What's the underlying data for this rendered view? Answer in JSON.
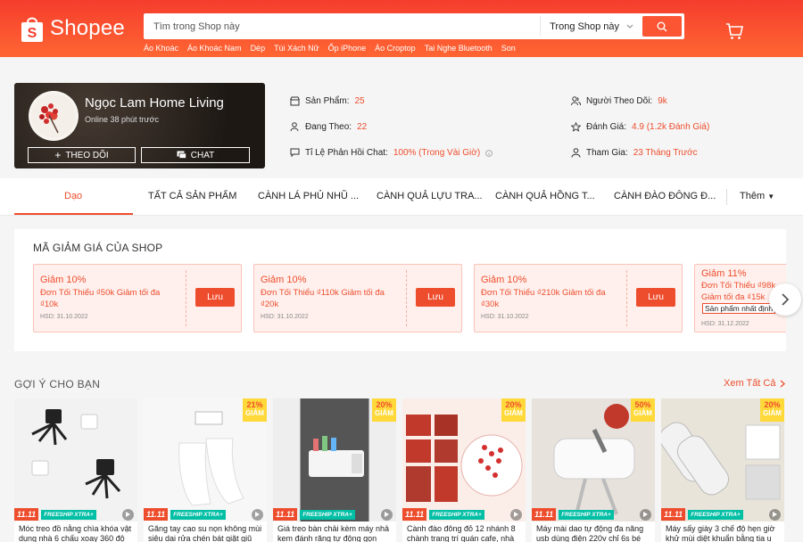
{
  "header": {
    "logo_text": "Shopee",
    "search_placeholder": "Tìm trong Shop này",
    "search_scope": "Trong Shop này",
    "quick_links": [
      "Áo Khoác",
      "Áo Khoác Nam",
      "Dép",
      "Túi Xách Nữ",
      "Ốp iPhone",
      "Áo Croptop",
      "Tai Nghe Bluetooth",
      "Son"
    ]
  },
  "shop": {
    "name": "Ngọc Lam Home Living",
    "online": "Online 38 phút trước",
    "follow_label": "THEO DÕI",
    "chat_label": "CHAT"
  },
  "stats": {
    "products_label": "Sản Phẩm:",
    "products_value": "25",
    "following_label": "Đang Theo:",
    "following_value": "22",
    "chat_rate_label": "Tỉ Lệ Phản Hồi Chat:",
    "chat_rate_value": "100% (Trong Vài Giờ)",
    "followers_label": "Người Theo Dõi:",
    "followers_value": "9k",
    "rating_label": "Đánh Giá:",
    "rating_value": "4.9 (1.2k Đánh Giá)",
    "joined_label": "Tham Gia:",
    "joined_value": "23 Tháng Trước"
  },
  "tabs": [
    "Dạo",
    "TẤT CẢ SẢN PHẨM",
    "CÀNH LÁ PHỦ NHŨ ...",
    "CÀNH QUẢ LỰU TRA...",
    "CÀNH QUẢ HỒNG T...",
    "CÀNH ĐÀO ĐÔNG Đ...",
    "Thêm"
  ],
  "vouchers": {
    "title": "MÃ GIẢM GIÁ CỦA SHOP",
    "button_label": "Lưu",
    "items": [
      {
        "title": "Giảm 10%",
        "desc": "Đơn Tối Thiểu ₫50k Giảm tối đa ₫10k",
        "hsd": "HSD: 31.10.2022"
      },
      {
        "title": "Giảm 10%",
        "desc": "Đơn Tối Thiểu ₫110k Giảm tối đa ₫20k",
        "hsd": "HSD: 31.10.2022"
      },
      {
        "title": "Giảm 10%",
        "desc": "Đơn Tối Thiểu ₫210k Giảm tối đa ₫30k",
        "hsd": "HSD: 31.10.2022"
      },
      {
        "title": "Giảm 11%",
        "desc": "Đơn Tối Thiểu ₫98k Giảm tối đa ₫15k",
        "tag": "Sản phẩm nhất định",
        "hsd": "HSD: 31.12.2022"
      }
    ]
  },
  "recommend": {
    "title": "GỢI Ý CHO BẠN",
    "see_all": "Xem Tất Cả",
    "tag_1111": "11.11",
    "tag_freeship": "FREESHIP XTRA+",
    "discount_label": "GIẢM",
    "products": [
      {
        "name": "Móc treo đồ nằng chìa khóa vật dụng nhà 6 chấu xoay 360 độ",
        "discount": ""
      },
      {
        "name": "Găng tay cao su nọn không mùi siêu dai rửa chén bát giặt giũ",
        "discount": "21%"
      },
      {
        "name": "Giá treo bàn chải kèm máy nhả kem đánh răng tự động gọn",
        "discount": "20%"
      },
      {
        "name": "Cành đào đông đỏ 12 nhánh 8 chành trang trí quán cafe, nhà",
        "discount": "20%"
      },
      {
        "name": "Máy mài dao tự động đa năng usb dùng điện 220v chỉ 6s bé",
        "discount": "50%"
      },
      {
        "name": "Máy sấy giày 3 chế độ hẹn giờ khử mùi diệt khuẩn bằng tia u",
        "discount": "20%"
      }
    ]
  }
}
